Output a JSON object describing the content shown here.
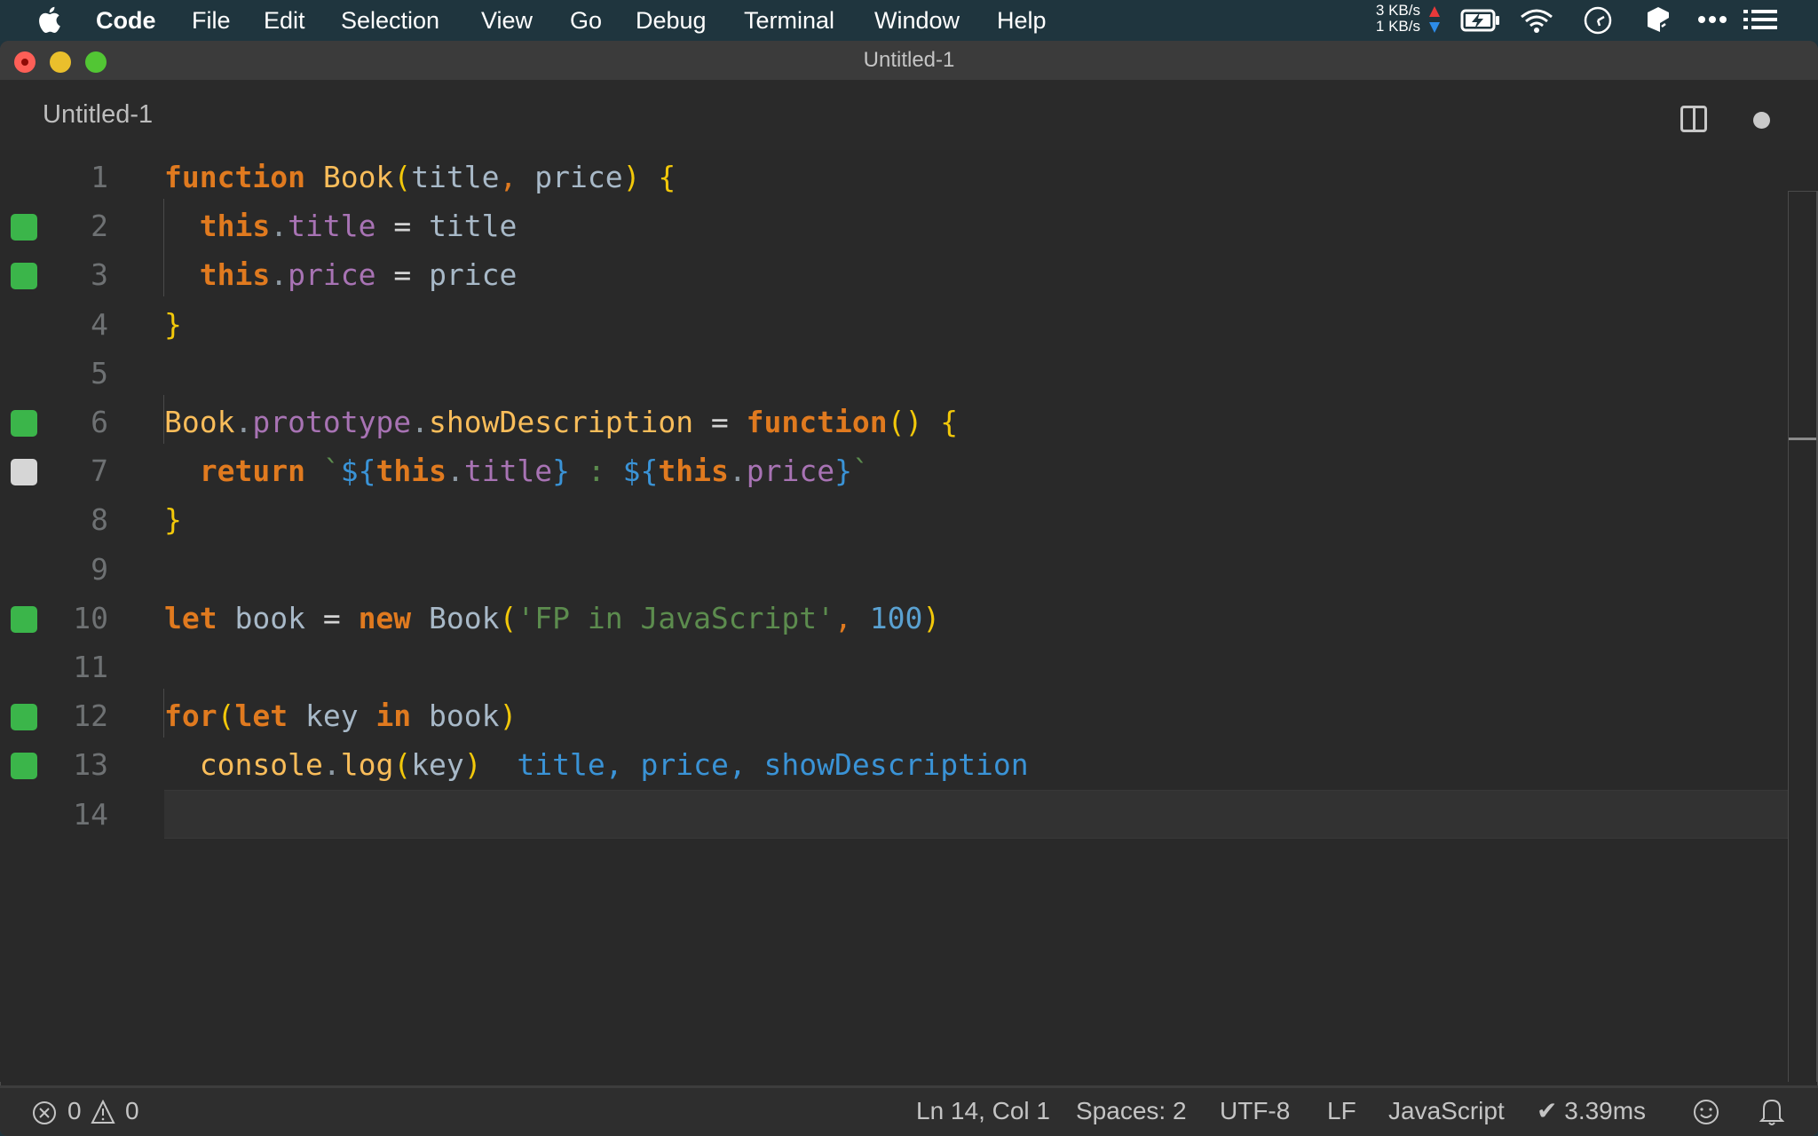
{
  "menubar": {
    "app_name": "Code",
    "items": [
      "File",
      "Edit",
      "Selection",
      "View",
      "Go",
      "Debug",
      "Terminal",
      "Window",
      "Help"
    ],
    "network": {
      "up": "3 KB/s",
      "down": "1 KB/s"
    },
    "tray_icons": [
      "battery-charging-icon",
      "wifi-icon",
      "clock-icon",
      "app-cube-icon",
      "more-dots-icon",
      "list-icon"
    ]
  },
  "window": {
    "title": "Untitled-1",
    "tab": {
      "label": "Untitled-1",
      "dirty": true
    }
  },
  "editor": {
    "lines": [
      {
        "n": "1",
        "marker": null,
        "indent": false,
        "tokens": [
          {
            "t": "function",
            "c": "kw"
          },
          {
            "t": " ",
            "c": "var"
          },
          {
            "t": "Book",
            "c": "fn"
          },
          {
            "t": "(",
            "c": "par"
          },
          {
            "t": "title",
            "c": "var"
          },
          {
            "t": ",",
            "c": "comma"
          },
          {
            "t": " price",
            "c": "var"
          },
          {
            "t": ")",
            "c": "par"
          },
          {
            "t": " ",
            "c": "var"
          },
          {
            "t": "{",
            "c": "par"
          }
        ]
      },
      {
        "n": "2",
        "marker": "green",
        "indent": true,
        "tokens": [
          {
            "t": "  ",
            "c": "var"
          },
          {
            "t": "this",
            "c": "kw"
          },
          {
            "t": ".",
            "c": "punc"
          },
          {
            "t": "title",
            "c": "prop"
          },
          {
            "t": " = ",
            "c": "op"
          },
          {
            "t": "title",
            "c": "var"
          }
        ]
      },
      {
        "n": "3",
        "marker": "green",
        "indent": true,
        "tokens": [
          {
            "t": "  ",
            "c": "var"
          },
          {
            "t": "this",
            "c": "kw"
          },
          {
            "t": ".",
            "c": "punc"
          },
          {
            "t": "price",
            "c": "prop"
          },
          {
            "t": " = ",
            "c": "op"
          },
          {
            "t": "price",
            "c": "var"
          }
        ]
      },
      {
        "n": "4",
        "marker": null,
        "indent": false,
        "tokens": [
          {
            "t": "}",
            "c": "par"
          }
        ]
      },
      {
        "n": "5",
        "marker": null,
        "indent": false,
        "tokens": []
      },
      {
        "n": "6",
        "marker": "green",
        "indent": false,
        "tokens": [
          {
            "t": "Book",
            "c": "fn"
          },
          {
            "t": ".",
            "c": "punc"
          },
          {
            "t": "prototype",
            "c": "prop"
          },
          {
            "t": ".",
            "c": "punc"
          },
          {
            "t": "showDescription",
            "c": "fn"
          },
          {
            "t": " = ",
            "c": "op"
          },
          {
            "t": "function",
            "c": "kw"
          },
          {
            "t": "()",
            "c": "par"
          },
          {
            "t": " ",
            "c": "var"
          },
          {
            "t": "{",
            "c": "par"
          }
        ]
      },
      {
        "n": "7",
        "marker": "gray",
        "indent": true,
        "tokens": [
          {
            "t": "  ",
            "c": "var"
          },
          {
            "t": "return",
            "c": "kw"
          },
          {
            "t": " ",
            "c": "var"
          },
          {
            "t": "`",
            "c": "tick"
          },
          {
            "t": "${",
            "c": "tpl"
          },
          {
            "t": "this",
            "c": "kw"
          },
          {
            "t": ".",
            "c": "punc"
          },
          {
            "t": "title",
            "c": "prop"
          },
          {
            "t": "}",
            "c": "tpl"
          },
          {
            "t": " : ",
            "c": "str"
          },
          {
            "t": "${",
            "c": "tpl"
          },
          {
            "t": "this",
            "c": "kw"
          },
          {
            "t": ".",
            "c": "punc"
          },
          {
            "t": "price",
            "c": "prop"
          },
          {
            "t": "}",
            "c": "tpl"
          },
          {
            "t": "`",
            "c": "tick"
          }
        ]
      },
      {
        "n": "8",
        "marker": null,
        "indent": false,
        "tokens": [
          {
            "t": "}",
            "c": "par"
          }
        ]
      },
      {
        "n": "9",
        "marker": null,
        "indent": false,
        "tokens": []
      },
      {
        "n": "10",
        "marker": "green",
        "indent": false,
        "tokens": [
          {
            "t": "let",
            "c": "kw"
          },
          {
            "t": " book",
            "c": "var"
          },
          {
            "t": " = ",
            "c": "op"
          },
          {
            "t": "new",
            "c": "kw"
          },
          {
            "t": " Book",
            "c": "var"
          },
          {
            "t": "(",
            "c": "par"
          },
          {
            "t": "'FP in JavaScript'",
            "c": "str"
          },
          {
            "t": ",",
            "c": "comma"
          },
          {
            "t": " ",
            "c": "var"
          },
          {
            "t": "100",
            "c": "num"
          },
          {
            "t": ")",
            "c": "par"
          }
        ]
      },
      {
        "n": "11",
        "marker": null,
        "indent": false,
        "tokens": []
      },
      {
        "n": "12",
        "marker": "green",
        "indent": false,
        "tokens": [
          {
            "t": "for",
            "c": "kw"
          },
          {
            "t": "(",
            "c": "par"
          },
          {
            "t": "let",
            "c": "kw"
          },
          {
            "t": " key ",
            "c": "var"
          },
          {
            "t": "in",
            "c": "kw"
          },
          {
            "t": " book",
            "c": "var"
          },
          {
            "t": ")",
            "c": "par"
          }
        ]
      },
      {
        "n": "13",
        "marker": "green",
        "indent": true,
        "tokens": [
          {
            "t": "  ",
            "c": "var"
          },
          {
            "t": "console",
            "c": "fn"
          },
          {
            "t": ".",
            "c": "punc"
          },
          {
            "t": "log",
            "c": "fn"
          },
          {
            "t": "(",
            "c": "par"
          },
          {
            "t": "key",
            "c": "var"
          },
          {
            "t": ")",
            "c": "par"
          },
          {
            "t": "  title, price, showDescription",
            "c": "inline-res"
          }
        ]
      },
      {
        "n": "14",
        "marker": null,
        "indent": false,
        "current": true,
        "tokens": []
      }
    ]
  },
  "statusbar": {
    "errors": "0",
    "warnings": "0",
    "position": "Ln 14, Col 1",
    "spaces": "Spaces: 2",
    "encoding": "UTF-8",
    "eol": "LF",
    "language": "JavaScript",
    "timing": "✔ 3.39ms"
  }
}
